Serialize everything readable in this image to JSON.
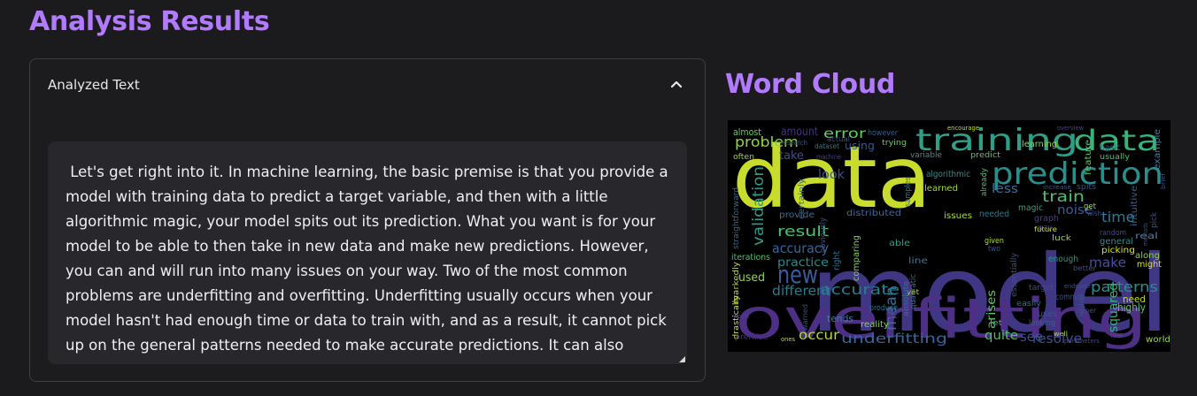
{
  "page": {
    "title": "Analysis Results"
  },
  "analyzed_text": {
    "label": "Analyzed Text",
    "content": " Let's get right into it. In machine learning, the basic premise is that you provide a model with training data to predict a target variable, and then with a little algorithmic magic, your model spits out its prediction. What you want is for your model to be able to then take in new data and make new predictions. However, you can and will run into many issues on your way. Two of the most common problems are underfitting and overfitting. Underfitting usually occurs when your model hasn't had enough time or data to train with, and as a result, it cannot pick up on the general patterns needed to make accurate predictions. It can also"
  },
  "word_cloud": {
    "title": "Word Cloud",
    "background": "#000000",
    "words": [
      {
        "text": "model",
        "color": "#3f3784"
      },
      {
        "text": "data",
        "color": "#c8dc2e"
      },
      {
        "text": "overfitting",
        "color": "#4d2f85"
      },
      {
        "text": "training",
        "color": "#2e9f86"
      },
      {
        "text": "data",
        "color": "#37b37c"
      },
      {
        "text": "prediction",
        "color": "#2a8f8c"
      },
      {
        "text": "new",
        "color": "#3a5c9c"
      },
      {
        "text": "problem",
        "color": "#8fd24a"
      },
      {
        "text": "accurate",
        "color": "#2a7b8e"
      },
      {
        "text": "result",
        "color": "#4ec171"
      },
      {
        "text": "underfitting",
        "color": "#3568a0"
      },
      {
        "text": "error",
        "color": "#67c964"
      },
      {
        "text": "train",
        "color": "#4cc070"
      },
      {
        "text": "time",
        "color": "#31789b"
      },
      {
        "text": "patterns",
        "color": "#2c8e8c"
      },
      {
        "text": "make",
        "color": "#4b4ea0"
      },
      {
        "text": "accuracy",
        "color": "#35679e"
      },
      {
        "text": "validation",
        "color": "#319c88"
      },
      {
        "text": "practice",
        "color": "#2b8a8d"
      },
      {
        "text": "different",
        "color": "#2a7b8e"
      },
      {
        "text": "occur",
        "color": "#b3d83b"
      },
      {
        "text": "quite",
        "color": "#4fc16d"
      },
      {
        "text": "mean",
        "color": "#2f6f98"
      },
      {
        "text": "used",
        "color": "#96d546"
      },
      {
        "text": "look",
        "color": "#3b5494"
      },
      {
        "text": "noise",
        "color": "#3c5e9a"
      },
      {
        "text": "less",
        "color": "#3b6ea0"
      },
      {
        "text": "see",
        "color": "#3d4e98"
      },
      {
        "text": "resolve",
        "color": "#3b4f95"
      },
      {
        "text": "arises",
        "color": "#5dc863"
      },
      {
        "text": "squared",
        "color": "#34b679"
      },
      {
        "text": "highly",
        "color": "#5cc863"
      },
      {
        "text": "need",
        "color": "#c6da2f"
      },
      {
        "text": "tends",
        "color": "#3f7ea5"
      },
      {
        "text": "almost",
        "color": "#66ca5f"
      },
      {
        "text": "amount",
        "color": "#46327e"
      },
      {
        "text": "using",
        "color": "#38598c"
      },
      {
        "text": "take",
        "color": "#3d4e8a"
      },
      {
        "text": "algorithmic",
        "color": "#2e8e8c"
      },
      {
        "text": "learned",
        "color": "#9fd939"
      },
      {
        "text": "graph",
        "color": "#4f3e8a"
      },
      {
        "text": "magic",
        "color": "#2ea386"
      },
      {
        "text": "issues",
        "color": "#a9db33"
      },
      {
        "text": "needed",
        "color": "#2a7b8e"
      },
      {
        "text": "provide",
        "color": "#35709a"
      },
      {
        "text": "distributed",
        "color": "#3d6aa0"
      },
      {
        "text": "able",
        "color": "#26a584"
      },
      {
        "text": "line",
        "color": "#3f76a0"
      },
      {
        "text": "comparing",
        "color": "#7fd34e"
      },
      {
        "text": "luck",
        "color": "#99d644"
      },
      {
        "text": "general",
        "color": "#2a8f8c"
      },
      {
        "text": "picking",
        "color": "#d5e21a"
      },
      {
        "text": "real",
        "color": "#4c7fa8"
      },
      {
        "text": "might",
        "color": "#dde318"
      },
      {
        "text": "along",
        "color": "#88d548"
      },
      {
        "text": "given",
        "color": "#b5de2b"
      },
      {
        "text": "enough",
        "color": "#1f9e89"
      },
      {
        "text": "common",
        "color": "#3d4e8a"
      },
      {
        "text": "uses",
        "color": "#39558c"
      },
      {
        "text": "world",
        "color": "#9fd939"
      },
      {
        "text": "iterations",
        "color": "#49c16d"
      },
      {
        "text": "produce",
        "color": "#2b748e"
      },
      {
        "text": "reality",
        "color": "#85d54a"
      },
      {
        "text": "fit",
        "color": "#46327e"
      },
      {
        "text": "yet",
        "color": "#c3df2a"
      },
      {
        "text": "target",
        "color": "#3d4e8a"
      },
      {
        "text": "feature",
        "color": "#56c667"
      },
      {
        "text": "basic",
        "color": "#39558c"
      },
      {
        "text": "usually",
        "color": "#4dc06c"
      },
      {
        "text": "example",
        "color": "#3f7ea5"
      },
      {
        "text": "intuitive",
        "color": "#34618d"
      },
      {
        "text": "random",
        "color": "#3d4e8a"
      },
      {
        "text": "learning",
        "color": "#88d548"
      },
      {
        "text": "predict",
        "color": "#5ac863"
      },
      {
        "text": "variable",
        "color": "#3d8ea5"
      },
      {
        "text": "dataset",
        "color": "#2a788e"
      },
      {
        "text": "actual",
        "color": "#3a538b"
      },
      {
        "text": "however",
        "color": "#33638d"
      },
      {
        "text": "trying",
        "color": "#6cce59"
      },
      {
        "text": "overview",
        "color": "#3f4889"
      },
      {
        "text": "encourage",
        "color": "#c2df23"
      },
      {
        "text": "research",
        "color": "#3b528b"
      },
      {
        "text": "machine",
        "color": "#4b3f8b"
      },
      {
        "text": "often",
        "color": "#9ad83c"
      },
      {
        "text": "markedly",
        "color": "#b4dd2b"
      },
      {
        "text": "drastically",
        "color": "#cbe02a"
      },
      {
        "text": "straightforward",
        "color": "#31688e"
      },
      {
        "text": "certainly",
        "color": "#2f6b8e"
      },
      {
        "text": "obviously",
        "color": "#3b528b"
      },
      {
        "text": "right",
        "color": "#2d718e"
      },
      {
        "text": "absolute",
        "color": "#2c728e"
      },
      {
        "text": "quadratic",
        "color": "#2f6c8e"
      },
      {
        "text": "already",
        "color": "#47c06f"
      },
      {
        "text": "samples",
        "color": "#2a788e"
      },
      {
        "text": "spits",
        "color": "#3b528b"
      },
      {
        "text": "essentially",
        "color": "#3b528b"
      },
      {
        "text": "would",
        "color": "#3f4889"
      },
      {
        "text": "premise",
        "color": "#46307e"
      },
      {
        "text": "ones",
        "color": "#c2df23"
      },
      {
        "text": "warned",
        "color": "#3b528b"
      },
      {
        "text": "future",
        "color": "#d8e219"
      },
      {
        "text": "increase",
        "color": "#3b528b"
      },
      {
        "text": "two",
        "color": "#3b528b"
      },
      {
        "text": "let",
        "color": "#35b779"
      },
      {
        "text": "easily",
        "color": "#2c728e"
      },
      {
        "text": "well",
        "color": "#a8db34"
      },
      {
        "text": "looking",
        "color": "#33638d"
      },
      {
        "text": "parameters",
        "color": "#3f4889"
      },
      {
        "text": "methods",
        "color": "#3b528b"
      },
      {
        "text": "pick",
        "color": "#3b528b"
      },
      {
        "text": "get",
        "color": "#a2da37"
      },
      {
        "text": "wish",
        "color": "#3b528b"
      },
      {
        "text": "higher",
        "color": "#3b528b"
      },
      {
        "text": "hyper",
        "color": "#3b528b"
      },
      {
        "text": "endeavors",
        "color": "#3b528b"
      },
      {
        "text": "better",
        "color": "#3b528b"
      },
      {
        "text": "brief",
        "color": "#3b528b"
      },
      {
        "text": "like",
        "color": "#3b528b"
      },
      {
        "text": "way",
        "color": "#3b528b"
      }
    ]
  }
}
